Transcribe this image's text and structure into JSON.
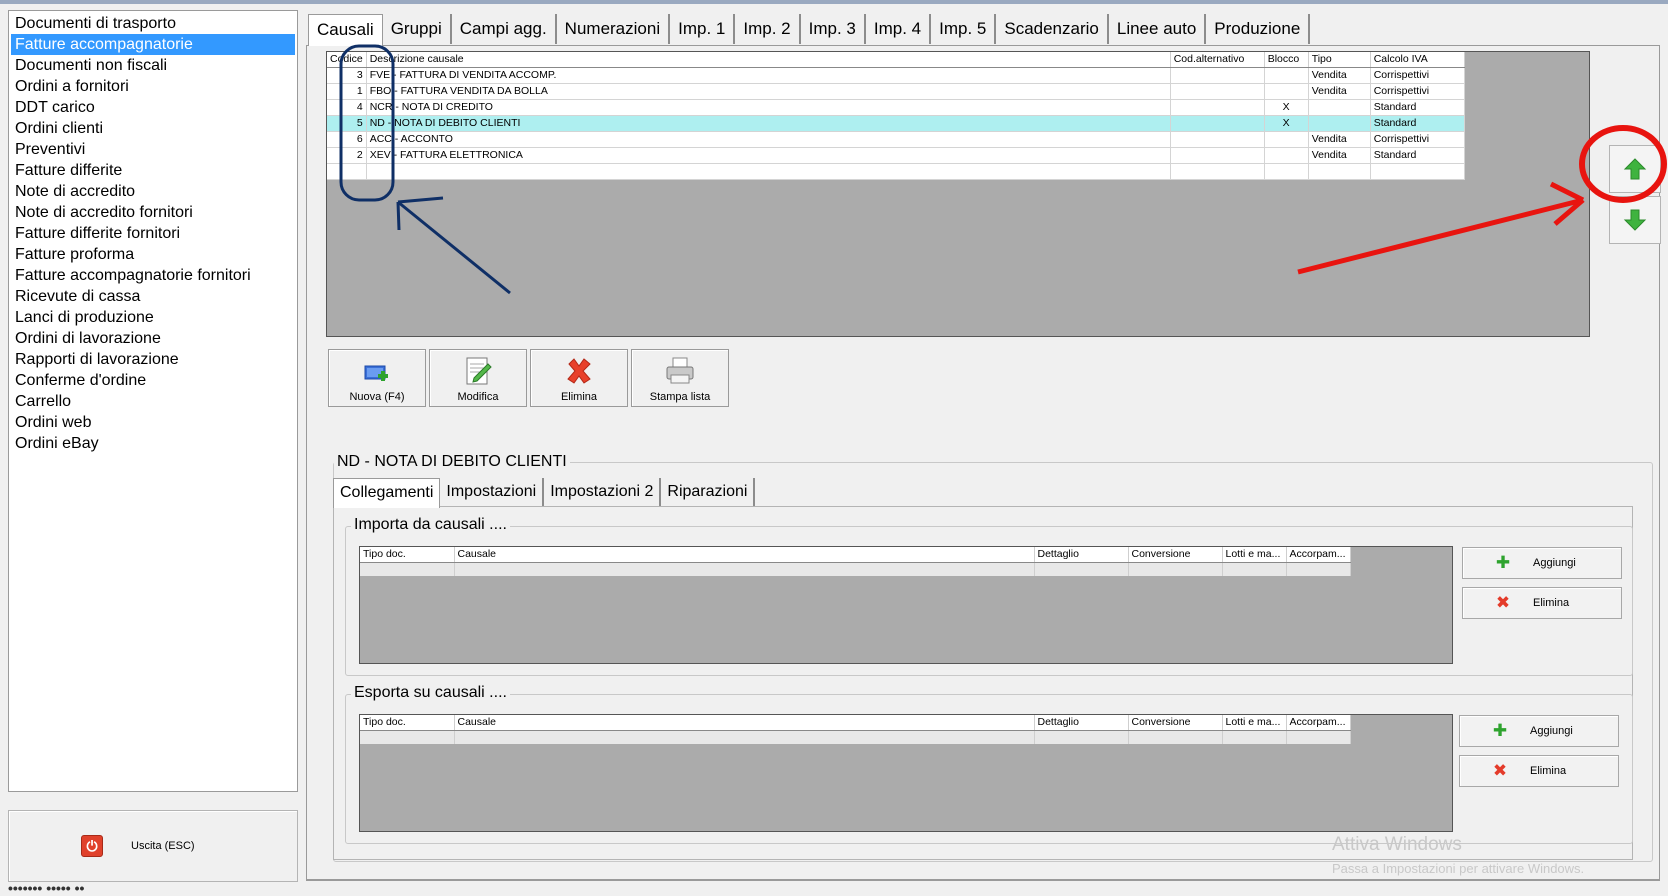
{
  "sidebar": {
    "items": [
      "Documenti di trasporto",
      "Fatture accompagnatorie",
      "Documenti non fiscali",
      "Ordini a fornitori",
      "DDT carico",
      "Ordini clienti",
      "Preventivi",
      "Fatture differite",
      "Note di accredito",
      "Note di accredito fornitori",
      "Fatture differite fornitori",
      "Fatture proforma",
      "Fatture accompagnatorie fornitori",
      "Ricevute di cassa",
      "Lanci di produzione",
      "Ordini di lavorazione",
      "Rapporti di lavorazione",
      "Conferme d'ordine",
      "Carrello",
      "Ordini web",
      "Ordini eBay"
    ],
    "selected_index": 1,
    "exit_label": "Uscita (ESC)",
    "bottom_cut_text": "••••••• ••••• ••"
  },
  "tabs": [
    "Causali",
    "Gruppi",
    "Campi agg.",
    "Numerazioni",
    "Imp. 1",
    "Imp. 2",
    "Imp. 3",
    "Imp. 4",
    "Imp. 5",
    "Scadenzario",
    "Linee auto",
    "Produzione"
  ],
  "active_tab": 0,
  "causali": {
    "columns": [
      "Codice",
      "Descrizione causale",
      "Cod.alternativo",
      "Blocco",
      "Tipo",
      "Calcolo IVA"
    ],
    "rows": [
      {
        "codice": "3",
        "descrizione": "FVE - FATTURA DI VENDITA ACCOMP.",
        "cod_alt": "",
        "blocco": "",
        "tipo": "Vendita",
        "iva": "Corrispettivi"
      },
      {
        "codice": "1",
        "descrizione": "FBO - FATTURA VENDITA DA BOLLA",
        "cod_alt": "",
        "blocco": "",
        "tipo": "Vendita",
        "iva": "Corrispettivi"
      },
      {
        "codice": "4",
        "descrizione": "NCR - NOTA DI CREDITO",
        "cod_alt": "",
        "blocco": "X",
        "tipo": "",
        "iva": "Standard"
      },
      {
        "codice": "5",
        "descrizione": "ND - NOTA DI DEBITO CLIENTI",
        "cod_alt": "",
        "blocco": "X",
        "tipo": "",
        "iva": "Standard"
      },
      {
        "codice": "6",
        "descrizione": "ACC - ACCONTO",
        "cod_alt": "",
        "blocco": "",
        "tipo": "Vendita",
        "iva": "Corrispettivi"
      },
      {
        "codice": "2",
        "descrizione": "XEV - FATTURA ELETTRONICA",
        "cod_alt": "",
        "blocco": "",
        "tipo": "Vendita",
        "iva": "Standard"
      }
    ],
    "selected_row": 3
  },
  "actions": {
    "new": "Nuova (F4)",
    "edit": "Modifica",
    "delete": "Elimina",
    "print": "Stampa lista"
  },
  "detail": {
    "title": "ND - NOTA DI DEBITO CLIENTI",
    "subtabs": [
      "Collegamenti",
      "Impostazioni",
      "Impostazioni 2",
      "Riparazioni"
    ],
    "active_subtab": 0,
    "import_title": "Importa da causali ....",
    "export_title": "Esporta su causali ....",
    "link_columns": [
      "Tipo doc.",
      "Causale",
      "Dettaglio",
      "Conversione",
      "Lotti e ma...",
      "Accorpam..."
    ],
    "add_label": "Aggiungi",
    "delete_label": "Elimina"
  },
  "watermark": {
    "line1": "Attiva Windows",
    "line2": "Passa a Impostazioni per attivare Windows."
  },
  "colors": {
    "selection": "#3399ff",
    "row_highlight": "#aeeff0",
    "annotation_red": "#e8140f",
    "annotation_blue": "#0f2f66",
    "arrow_green": "#3fb33f"
  }
}
